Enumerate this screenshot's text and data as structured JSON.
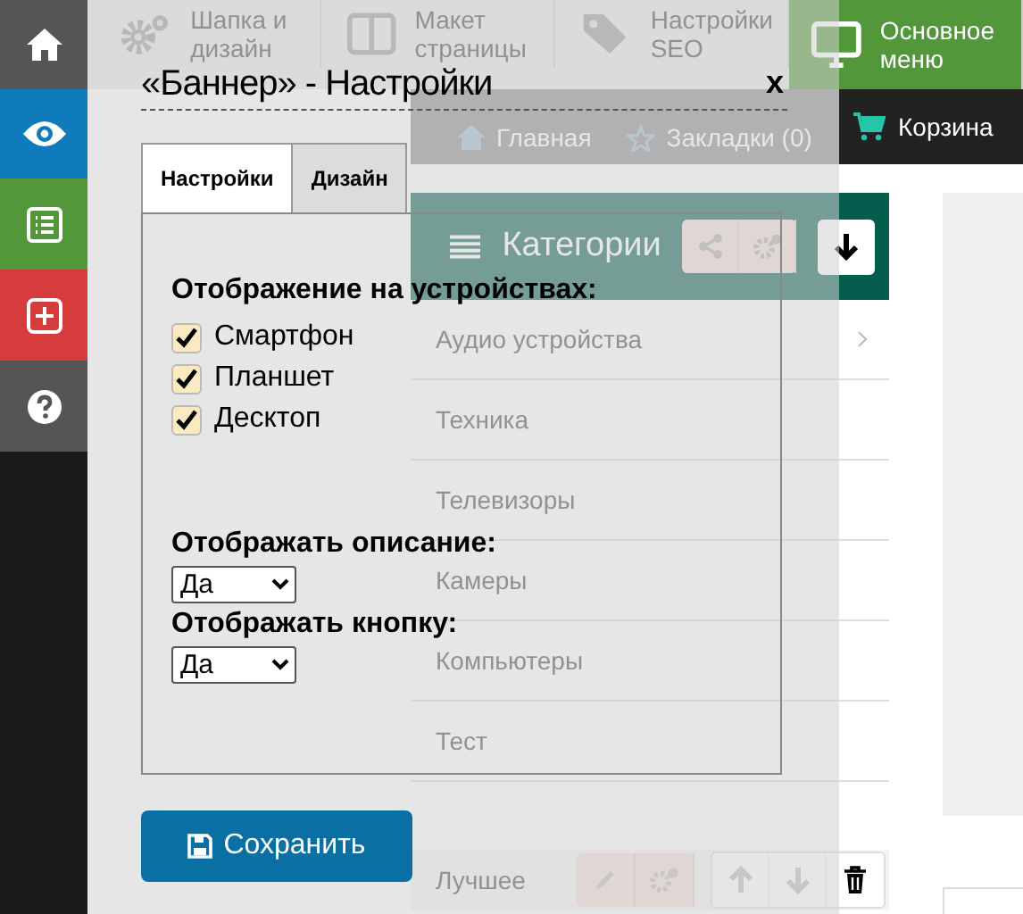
{
  "sidebar": {
    "items": [
      {
        "color": "#555555"
      },
      {
        "color": "#0f7bbd"
      },
      {
        "color": "#52973a"
      },
      {
        "color": "#d63c3c"
      },
      {
        "color": "#555555"
      }
    ]
  },
  "toolbar": {
    "items": [
      {
        "label": "Шапка и дизайн",
        "selected": false
      },
      {
        "label": "Макет страницы",
        "selected": false
      },
      {
        "label": "Настройки SEO",
        "selected": false
      },
      {
        "label": "Основное меню",
        "selected": true
      }
    ]
  },
  "nav": {
    "links": [
      "Главная",
      "Закладки (0)"
    ],
    "cart": "Корзина"
  },
  "categories": {
    "title": "Категории",
    "items": [
      {
        "label": "Аудио устройства",
        "has_children": true
      },
      {
        "label": "Техника",
        "has_children": false
      },
      {
        "label": "Телевизоры",
        "has_children": false
      },
      {
        "label": "Камеры",
        "has_children": false
      },
      {
        "label": "Компьютеры",
        "has_children": false
      },
      {
        "label": "Тест",
        "has_children": false
      }
    ]
  },
  "featured": {
    "label": "Лучшее"
  },
  "modal": {
    "title": "«Баннер» - Настройки",
    "close": "x",
    "tabs": [
      {
        "label": "Настройки",
        "selected": true
      },
      {
        "label": "Дизайн",
        "selected": false
      }
    ],
    "devices_heading": "Отображение на устройствах:",
    "devices": [
      {
        "label": "Смартфон",
        "checked": true
      },
      {
        "label": "Планшет",
        "checked": true
      },
      {
        "label": "Десктоп",
        "checked": true
      }
    ],
    "fields": [
      {
        "label": "Отображать описание:",
        "value": "Да"
      },
      {
        "label": "Отображать кнопку:",
        "value": "Да"
      }
    ],
    "save": "Сохранить"
  }
}
